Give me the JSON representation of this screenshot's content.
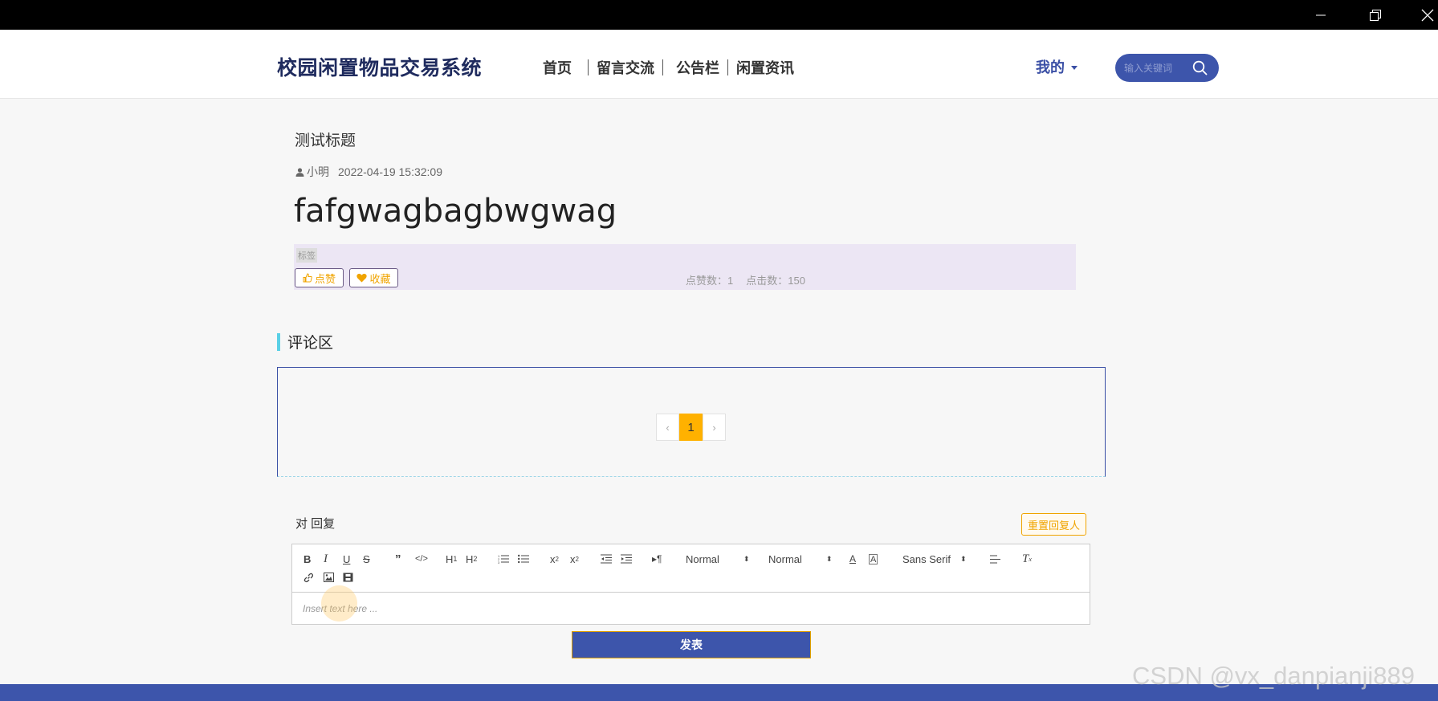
{
  "window": {
    "controls": [
      "minimize-icon",
      "restore-icon",
      "close-icon"
    ]
  },
  "header": {
    "site_title": "校园闲置物品交易系统",
    "nav": [
      {
        "label": "首页"
      },
      {
        "label": "留言交流"
      },
      {
        "label": "公告栏"
      },
      {
        "label": "闲置资讯"
      }
    ],
    "user_menu": "我的",
    "search_placeholder": "输入关键词"
  },
  "post": {
    "title": "测试标题",
    "author": "小明",
    "date": "2022-04-19 15:32:09",
    "content": "fafgwagbagbwgwag",
    "tags_label": "标签",
    "like_label": "点赞",
    "fav_label": "收藏",
    "like_count_label": "点赞数：1",
    "click_count_label": "点击数：150"
  },
  "comments": {
    "section_title": "评论区",
    "pager": {
      "prev": "‹",
      "current": "1",
      "next": "›"
    }
  },
  "reply": {
    "label": "对 回复",
    "reset_label": "重置回复人",
    "toolbar": {
      "header_select": "Normal",
      "size_select": "Normal",
      "font_select": "Sans Serif"
    },
    "placeholder": "Insert text here ...",
    "submit_label": "发表"
  },
  "colors": {
    "primary": "#3d55ab",
    "accent": "#f0a400",
    "title": "#1f2b5e"
  },
  "watermark": "CSDN @vx_danpianji889"
}
